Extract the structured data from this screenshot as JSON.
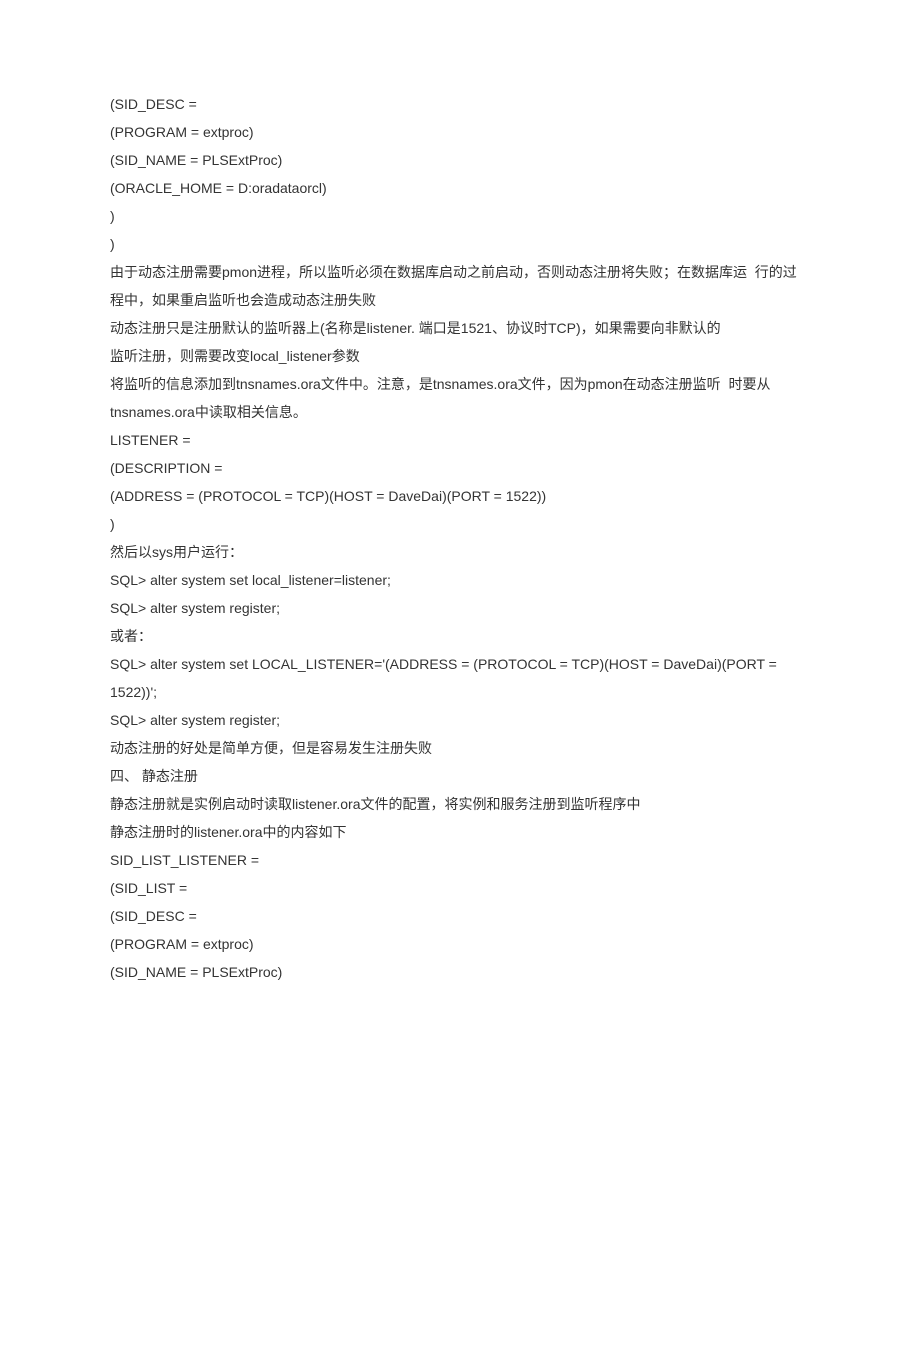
{
  "lines": [
    "(SID_DESC =",
    "(PROGRAM = extproc)",
    "(SID_NAME = PLSExtProc)",
    "(ORACLE_HOME = D:oradataorcl)",
    ")",
    ")",
    "由于动态注册需要pmon进程，所以监听必须在数据库启动之前启动，否则动态注册将失败；在数据库运  行的过程中，如果重启监听也会造成动态注册失败",
    "动态注册只是注册默认的监听器上(名称是listener. 端口是1521、协议时TCP)，如果需要向非默认的",
    "监听注册，则需要改变local_listener参数",
    "将监听的信息添加到tnsnames.ora文件中。注意，是tnsnames.ora文件，因为pmon在动态注册监听  时要从tnsnames.ora中读取相关信息。",
    "LISTENER =",
    "(DESCRIPTION =",
    "(ADDRESS = (PROTOCOL = TCP)(HOST = DaveDai)(PORT = 1522))",
    ")",
    "然后以sys用户运行：",
    "SQL> alter system set local_listener=listener;",
    "SQL> alter system register;",
    "或者：",
    "SQL> alter system set LOCAL_LISTENER='(ADDRESS = (PROTOCOL = TCP)(HOST = DaveDai)(PORT = 1522))';",
    "SQL> alter system register;",
    "动态注册的好处是简单方便，但是容易发生注册失败",
    "四、 静态注册",
    "静态注册就是实例启动时读取listener.ora文件的配置，将实例和服务注册到监听程序中",
    "静态注册时的listener.ora中的内容如下",
    "SID_LIST_LISTENER =",
    "(SID_LIST =",
    "(SID_DESC =",
    "(PROGRAM = extproc)",
    "(SID_NAME = PLSExtProc)"
  ]
}
